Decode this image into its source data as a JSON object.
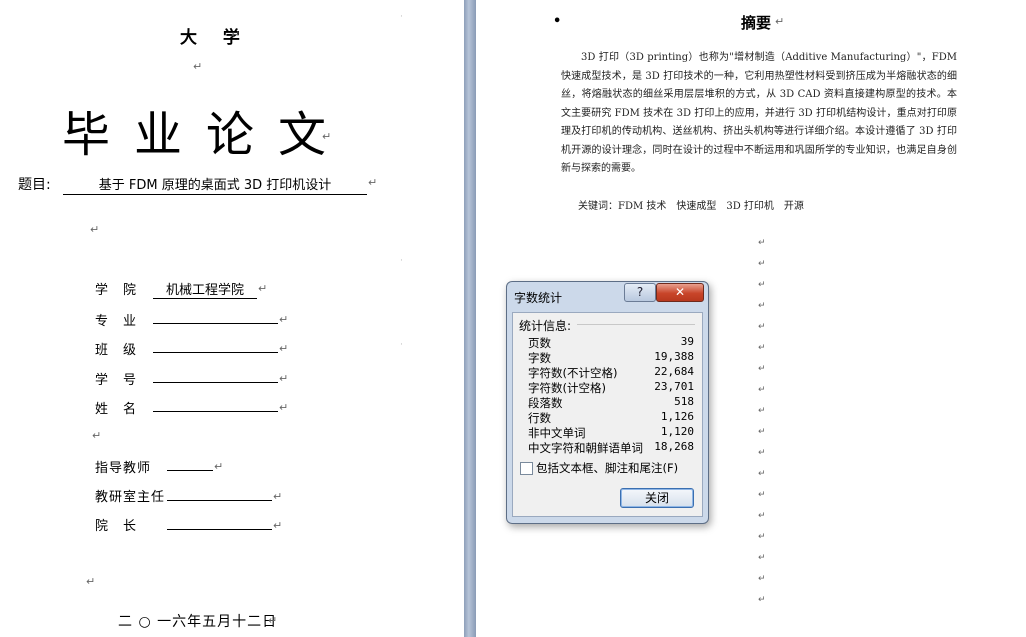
{
  "left_page": {
    "university": "大 学",
    "thesis_title": "毕业论文",
    "topic_label": "题目:",
    "topic_value": "基于 FDM 原理的桌面式 3D 打印机设计",
    "fields": [
      {
        "label": "学　院",
        "value": "机械工程学院"
      },
      {
        "label": "专　业",
        "value": ""
      },
      {
        "label": "班　级",
        "value": ""
      },
      {
        "label": "学　号",
        "value": ""
      },
      {
        "label": "姓　名",
        "value": ""
      }
    ],
    "advisors": [
      {
        "label": "指导教师",
        "value": ""
      },
      {
        "label": "教研室主任",
        "value": ""
      },
      {
        "label": "院　长",
        "value": ""
      }
    ],
    "date": "二 ○ 一六年五月十二日",
    "paragraph_mark": "↵"
  },
  "right_page": {
    "bullet": "•",
    "abstract_title": "摘要",
    "abstract_body": "3D 打印（3D printing）也称为\"增材制造（Additive Manufacturing）\"，FDM 快速成型技术，是 3D 打印技术的一种，它利用热塑性材料受到挤压成为半熔融状态的细丝，将熔融状态的细丝采用层层堆积的方式，从 3D CAD 资料直接建构原型的技术。本文主要研究 FDM 技术在 3D 打印上的应用，并进行 3D 打印机结构设计，重点对打印原理及打印机的传动机构、送丝机构、挤出头机构等进行详细介绍。本设计遵循了 3D 打印机开源的设计理念，同时在设计的过程中不断运用和巩固所学的专业知识，也满足自身创新与探索的需要。",
    "keywords": "关键词：FDM 技术　快速成型　3D 打印机　开源"
  },
  "dialog": {
    "title": "字数统计",
    "help_label": "?",
    "close_x": "✕",
    "stats_header": "统计信息:",
    "stats": [
      {
        "label": "页数",
        "value": "39"
      },
      {
        "label": "字数",
        "value": "19,388"
      },
      {
        "label": "字符数(不计空格)",
        "value": "22,684"
      },
      {
        "label": "字符数(计空格)",
        "value": "23,701"
      },
      {
        "label": "段落数",
        "value": "518"
      },
      {
        "label": "行数",
        "value": "1,126"
      },
      {
        "label": "非中文单词",
        "value": "1,120"
      },
      {
        "label": "中文字符和朝鲜语单词",
        "value": "18,268"
      }
    ],
    "checkbox_label": "包括文本框、脚注和尾注(F)",
    "checkbox_checked": false,
    "close_button": "关闭"
  }
}
